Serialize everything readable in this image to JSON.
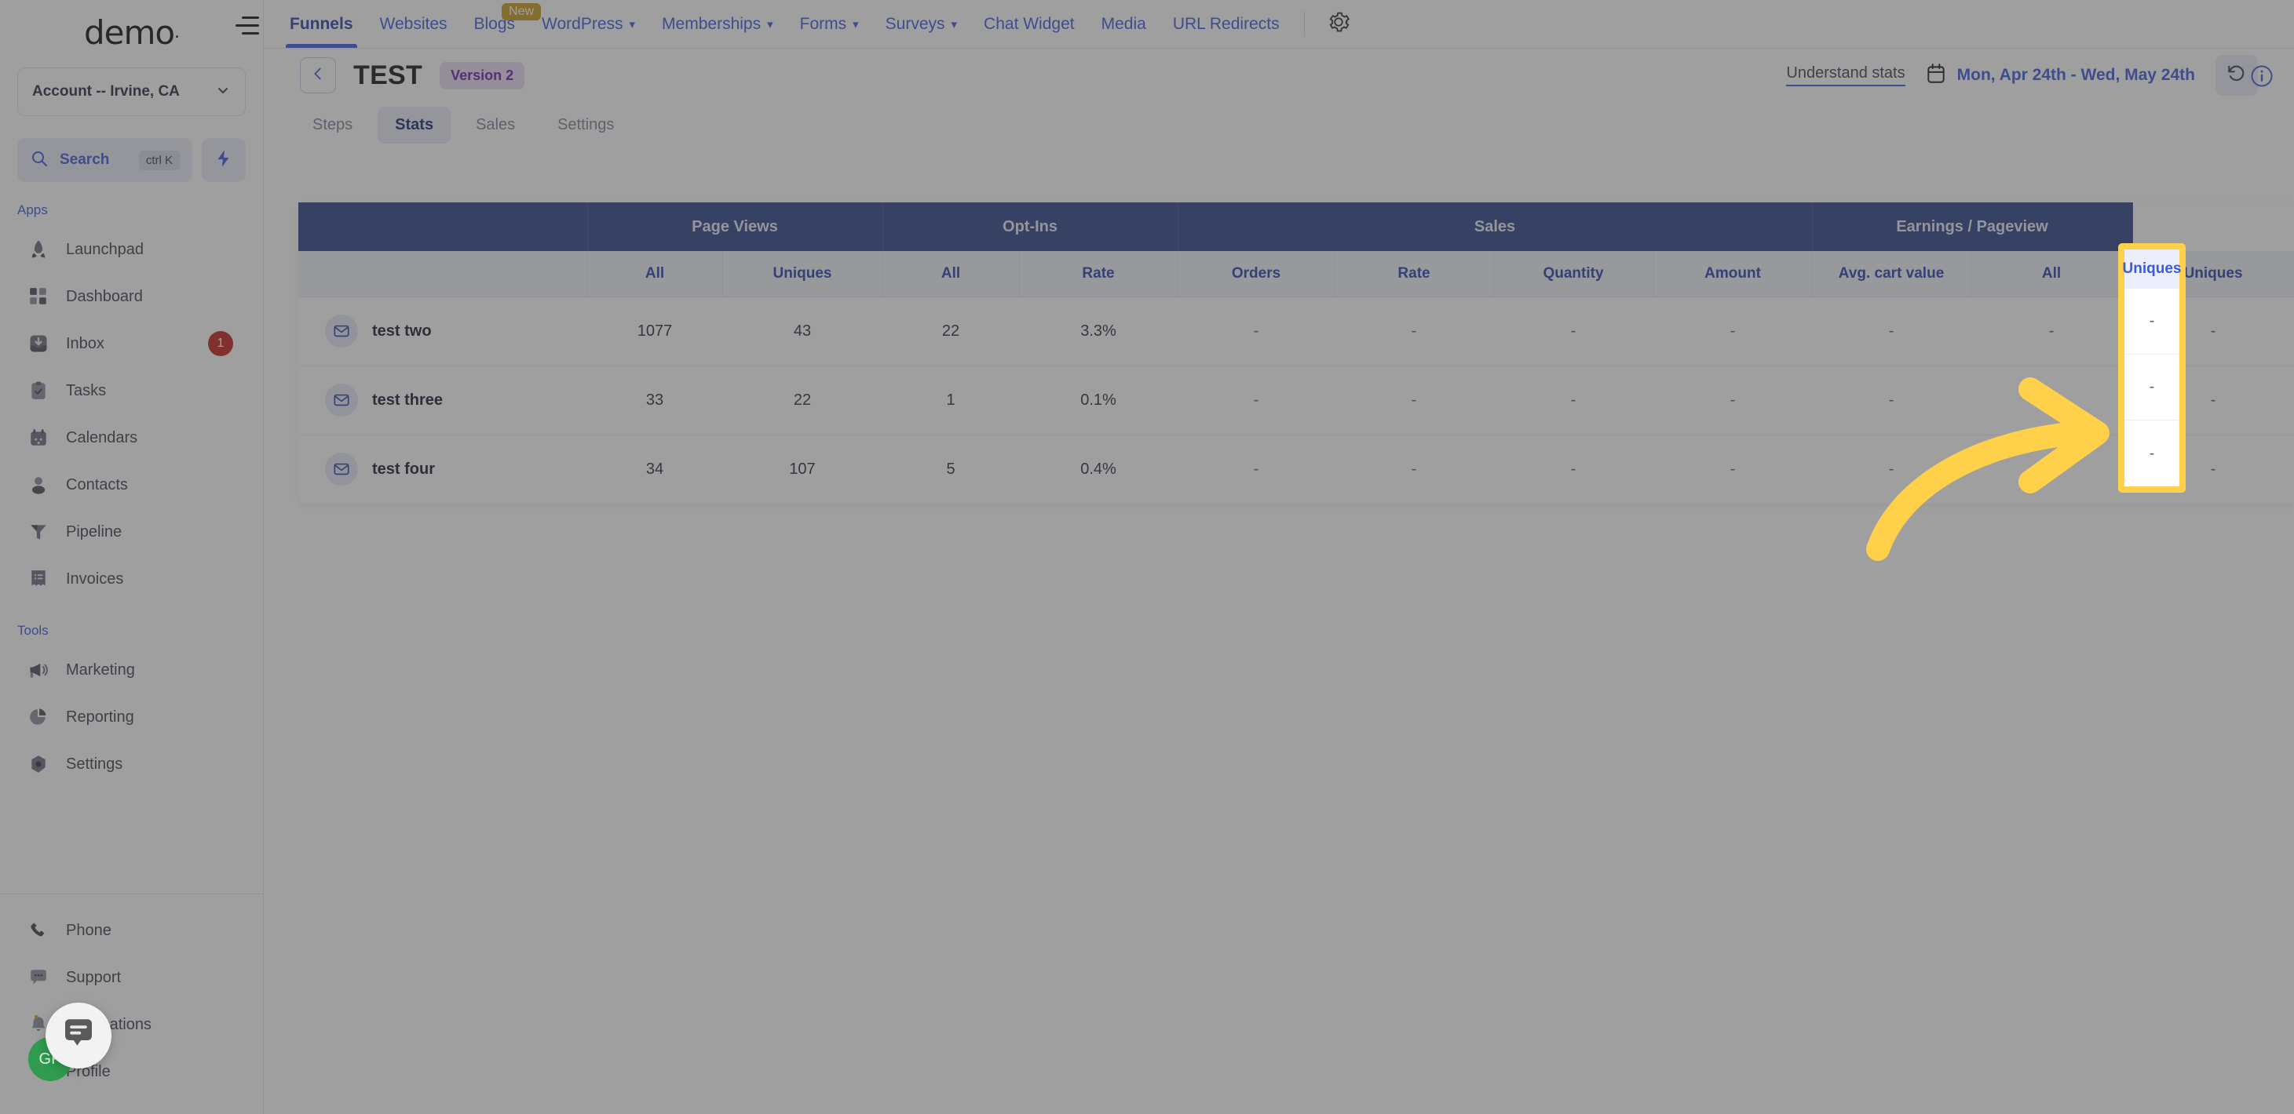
{
  "brand": {
    "name": "demo",
    "dot": "."
  },
  "sidebar": {
    "account": {
      "label": "Account -- Irvine, CA",
      "chevron": "chevron-down"
    },
    "search": {
      "label": "Search",
      "shortcut": "ctrl K"
    },
    "sections": [
      {
        "label": "Apps",
        "items": [
          {
            "label": "Launchpad",
            "icon": "rocket-icon"
          },
          {
            "label": "Dashboard",
            "icon": "grid-icon"
          },
          {
            "label": "Inbox",
            "icon": "inbox-icon",
            "badge": "1"
          },
          {
            "label": "Tasks",
            "icon": "clipboard-check-icon"
          },
          {
            "label": "Calendars",
            "icon": "calendar-icon"
          },
          {
            "label": "Contacts",
            "icon": "person-icon"
          },
          {
            "label": "Pipeline",
            "icon": "funnel-icon"
          },
          {
            "label": "Invoices",
            "icon": "receipt-icon"
          }
        ]
      },
      {
        "label": "Tools",
        "items": [
          {
            "label": "Marketing",
            "icon": "megaphone-icon"
          },
          {
            "label": "Reporting",
            "icon": "pie-chart-icon"
          },
          {
            "label": "Settings",
            "icon": "gear-hex-icon"
          }
        ]
      }
    ],
    "bottom_items": [
      {
        "label": "Phone",
        "icon": "phone-icon"
      },
      {
        "label": "Support",
        "icon": "chat-dots-icon"
      },
      {
        "label": "Notifications",
        "icon": "bell-icon"
      },
      {
        "label": "Profile",
        "icon": "avatar-icon"
      }
    ],
    "avatar_initials": "GP"
  },
  "topnav": {
    "items": [
      {
        "label": "Funnels",
        "active": true,
        "caret": false,
        "pill": ""
      },
      {
        "label": "Websites",
        "active": false,
        "caret": false,
        "pill": ""
      },
      {
        "label": "Blogs",
        "active": false,
        "caret": false,
        "pill": "New"
      },
      {
        "label": "WordPress",
        "active": false,
        "caret": true,
        "pill": ""
      },
      {
        "label": "Memberships",
        "active": false,
        "caret": true,
        "pill": ""
      },
      {
        "label": "Forms",
        "active": false,
        "caret": true,
        "pill": ""
      },
      {
        "label": "Surveys",
        "active": false,
        "caret": true,
        "pill": ""
      },
      {
        "label": "Chat Widget",
        "active": false,
        "caret": false,
        "pill": ""
      },
      {
        "label": "Media",
        "active": false,
        "caret": false,
        "pill": ""
      },
      {
        "label": "URL Redirects",
        "active": false,
        "caret": false,
        "pill": ""
      }
    ],
    "gear_icon": "gear-icon",
    "menu_icon": "hamburger-icon"
  },
  "header": {
    "back_icon": "chevron-left-icon",
    "title": "TEST",
    "version_badge": "Version 2",
    "understand_stats": "Understand stats",
    "calendar_icon": "calendar-icon",
    "date_range": "Mon, Apr 24th - Wed, May 24th",
    "refresh_icon": "refresh-icon",
    "info_icon": "info-icon"
  },
  "subtabs": [
    {
      "label": "Steps",
      "active": false
    },
    {
      "label": "Stats",
      "active": true
    },
    {
      "label": "Sales",
      "active": false
    },
    {
      "label": "Settings",
      "active": false
    }
  ],
  "table": {
    "groups": [
      {
        "label": "",
        "span": 1
      },
      {
        "label": "Page Views",
        "span": 2
      },
      {
        "label": "Opt-Ins",
        "span": 2
      },
      {
        "label": "Sales",
        "span": 4
      },
      {
        "label": "Earnings / Pageview",
        "span": 2
      }
    ],
    "columns": [
      "",
      "All",
      "Uniques",
      "All",
      "Rate",
      "Orders",
      "Rate",
      "Quantity",
      "Amount",
      "Avg. cart value",
      "All",
      "Uniques"
    ],
    "highlighted_column": "Uniques",
    "highlight_color": "#ffd04a",
    "rows": [
      {
        "icon": "mail-icon",
        "name": "test two",
        "cells": [
          "1077",
          "43",
          "22",
          "3.3%",
          "-",
          "-",
          "-",
          "-",
          "-",
          "-",
          "-"
        ]
      },
      {
        "icon": "mail-icon",
        "name": "test three",
        "cells": [
          "33",
          "22",
          "1",
          "0.1%",
          "-",
          "-",
          "-",
          "-",
          "-",
          "-",
          "-"
        ]
      },
      {
        "icon": "mail-icon",
        "name": "test four",
        "cells": [
          "34",
          "107",
          "5",
          "0.4%",
          "-",
          "-",
          "-",
          "-",
          "-",
          "-",
          "-"
        ]
      }
    ]
  },
  "annotation": {
    "type": "curved-arrow",
    "color": "#ffd04a",
    "points_to": "Uniques"
  }
}
